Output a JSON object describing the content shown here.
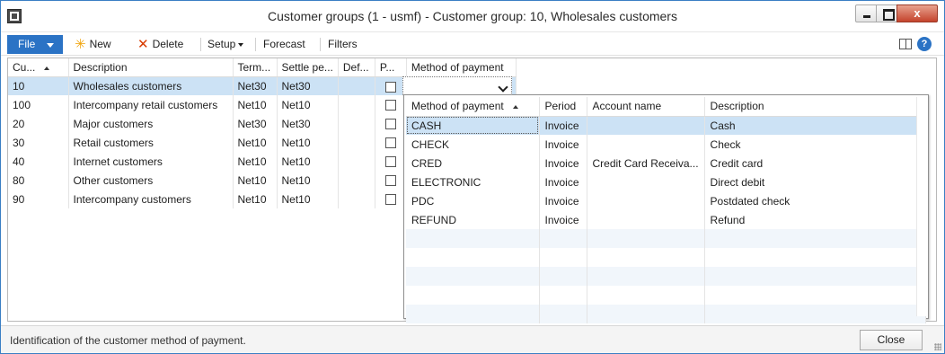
{
  "window": {
    "title": "Customer groups (1 - usmf) - Customer group: 10, Wholesales customers",
    "close_glyph": "x"
  },
  "ribbon": {
    "file_label": "File",
    "new_label": "New",
    "delete_label": "Delete",
    "setup_label": "Setup",
    "forecast_label": "Forecast",
    "filters_label": "Filters",
    "help_glyph": "?"
  },
  "grid": {
    "columns": [
      "Cu...",
      "Description",
      "Term...",
      "Settle pe...",
      "Def...",
      "P...",
      "Method of payment"
    ],
    "rows": [
      {
        "group": "10",
        "description": "Wholesales customers",
        "terms": "Net30",
        "settle": "Net30",
        "def": "",
        "checked": false,
        "selected": true
      },
      {
        "group": "100",
        "description": "Intercompany retail customers",
        "terms": "Net10",
        "settle": "Net10",
        "def": "",
        "checked": false
      },
      {
        "group": "20",
        "description": "Major customers",
        "terms": "Net30",
        "settle": "Net30",
        "def": "",
        "checked": false
      },
      {
        "group": "30",
        "description": "Retail customers",
        "terms": "Net10",
        "settle": "Net10",
        "def": "",
        "checked": false
      },
      {
        "group": "40",
        "description": "Internet customers",
        "terms": "Net10",
        "settle": "Net10",
        "def": "",
        "checked": false
      },
      {
        "group": "80",
        "description": "Other customers",
        "terms": "Net10",
        "settle": "Net10",
        "def": "",
        "checked": false
      },
      {
        "group": "90",
        "description": "Intercompany  customers",
        "terms": "Net10",
        "settle": "Net10",
        "def": "",
        "checked": false
      }
    ]
  },
  "lookup": {
    "columns": [
      "Method of payment",
      "Period",
      "Account name",
      "Description"
    ],
    "rows": [
      {
        "method": "CASH",
        "period": "Invoice",
        "account": "",
        "description": "Cash"
      },
      {
        "method": "CHECK",
        "period": "Invoice",
        "account": "",
        "description": "Check"
      },
      {
        "method": "CRED",
        "period": "Invoice",
        "account": "Credit Card Receiva...",
        "description": "Credit card"
      },
      {
        "method": "ELECTRONIC",
        "period": "Invoice",
        "account": "",
        "description": "Direct debit"
      },
      {
        "method": "PDC",
        "period": "Invoice",
        "account": "",
        "description": "Postdated check"
      },
      {
        "method": "REFUND",
        "period": "Invoice",
        "account": "",
        "description": "Refund"
      }
    ]
  },
  "status": {
    "text": "Identification of the customer method of payment.",
    "close_label": "Close"
  },
  "colors": {
    "accent": "#2b73c5",
    "selection": "#cce2f5",
    "close_button": "#c4432c"
  },
  "icons": [
    "app-icon",
    "new-star-icon",
    "delete-x-icon",
    "panel-icon",
    "help-icon",
    "chevron-down-icon"
  ]
}
